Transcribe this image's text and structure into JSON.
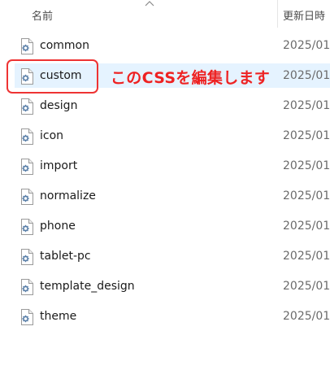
{
  "header": {
    "name_label": "名前",
    "date_label": "更新日時"
  },
  "files": [
    {
      "name": "common",
      "date": "2025/01/",
      "selected": false
    },
    {
      "name": "custom",
      "date": "2025/01/",
      "selected": true
    },
    {
      "name": "design",
      "date": "2025/01/",
      "selected": false
    },
    {
      "name": "icon",
      "date": "2025/01/",
      "selected": false
    },
    {
      "name": "import",
      "date": "2025/01/",
      "selected": false
    },
    {
      "name": "normalize",
      "date": "2025/01/",
      "selected": false
    },
    {
      "name": "phone",
      "date": "2025/01/",
      "selected": false
    },
    {
      "name": "tablet-pc",
      "date": "2025/01/",
      "selected": false
    },
    {
      "name": "template_design",
      "date": "2025/01/",
      "selected": false
    },
    {
      "name": "theme",
      "date": "2025/01/",
      "selected": false
    }
  ],
  "annotation": {
    "text": "このCSSを編集します",
    "color": "#ee2222"
  },
  "icon": "css-file-icon",
  "colors": {
    "selection": "#e5f3ff",
    "highlight_border": "#ee3333"
  }
}
